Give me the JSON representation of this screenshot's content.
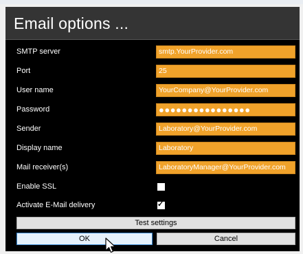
{
  "dialog": {
    "title": "Email options ...",
    "fields": [
      {
        "label": "SMTP server",
        "value": "smtp.YourProvider.com"
      },
      {
        "label": "Port",
        "value": "25"
      },
      {
        "label": "User name",
        "value": "YourCompany@YourProvider.com"
      },
      {
        "label": "Password",
        "value": "●●●●●●●●●●●●●●●●"
      },
      {
        "label": "Sender",
        "value": "Laboratory@YourProvider.com"
      },
      {
        "label": "Display name",
        "value": "Laboratory"
      },
      {
        "label": "Mail receiver(s)",
        "value": "LaboratoryManager@YourProvider.com"
      }
    ],
    "checkboxes": [
      {
        "label": "Enable SSL",
        "checked": false
      },
      {
        "label": "Activate E-Mail delivery",
        "checked": true,
        "mark": "✓"
      }
    ],
    "buttons": {
      "test": "Test settings",
      "ok": "OK",
      "cancel": "Cancel"
    }
  },
  "colors": {
    "field_bg": "#f0a22a",
    "dialog_bg": "#000000",
    "titlebar_bg": "#343434"
  }
}
